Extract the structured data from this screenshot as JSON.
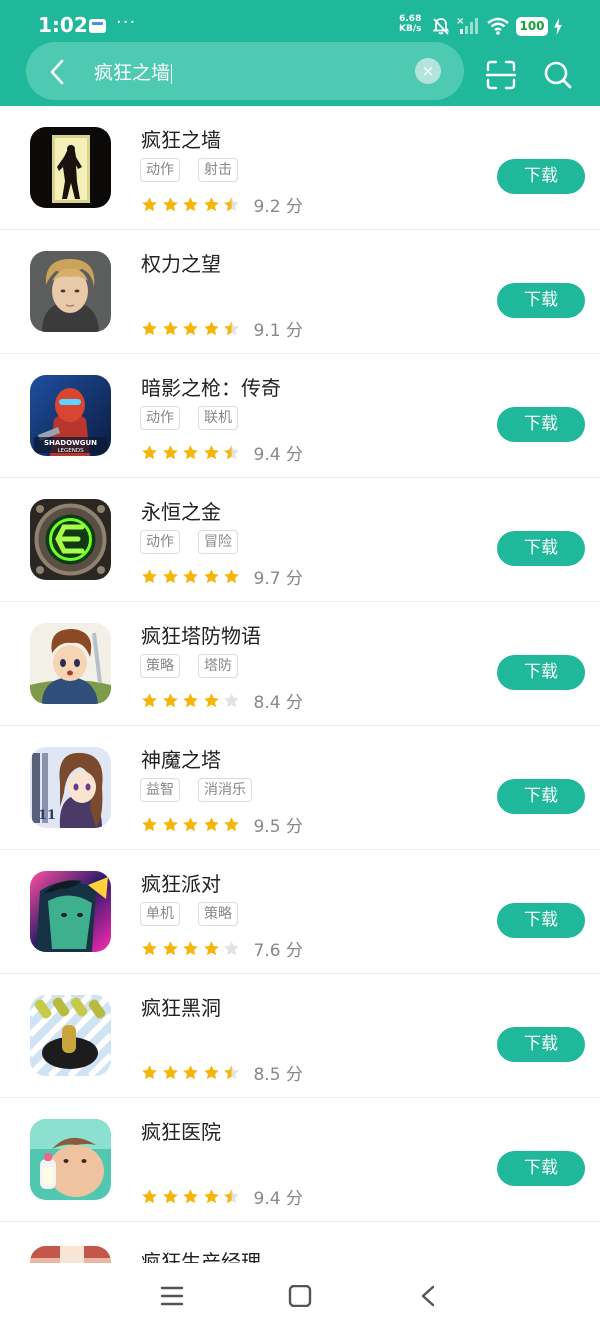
{
  "status": {
    "time": "1:02",
    "speed_value": "6.68",
    "speed_unit": "KB/s",
    "battery": "100"
  },
  "search": {
    "query": "疯狂之墙"
  },
  "download_label": "下载",
  "score_unit": "分",
  "games": [
    {
      "title": "疯狂之墙",
      "tags": [
        "动作",
        "射击"
      ],
      "rating": 4.5,
      "score": "9.2"
    },
    {
      "title": "权力之望",
      "tags": [],
      "rating": 4.5,
      "score": "9.1"
    },
    {
      "title": "暗影之枪：传奇",
      "tags": [
        "动作",
        "联机"
      ],
      "rating": 4.5,
      "score": "9.4"
    },
    {
      "title": "永恒之金",
      "tags": [
        "动作",
        "冒险"
      ],
      "rating": 5,
      "score": "9.7"
    },
    {
      "title": "疯狂塔防物语",
      "tags": [
        "策略",
        "塔防"
      ],
      "rating": 4,
      "score": "8.4"
    },
    {
      "title": "神魔之塔",
      "tags": [
        "益智",
        "消消乐"
      ],
      "rating": 5,
      "score": "9.5"
    },
    {
      "title": "疯狂派对",
      "tags": [
        "单机",
        "策略"
      ],
      "rating": 4,
      "score": "7.6"
    },
    {
      "title": "疯狂黑洞",
      "tags": [],
      "rating": 4.5,
      "score": "8.5"
    },
    {
      "title": "疯狂医院",
      "tags": [],
      "rating": 4.5,
      "score": "9.4"
    }
  ],
  "partial_item": {
    "title": "疯狂生产经理"
  },
  "colors": {
    "accent": "#1fb89b",
    "star": "#f5b50a",
    "star_empty": "#e2e2e2"
  }
}
